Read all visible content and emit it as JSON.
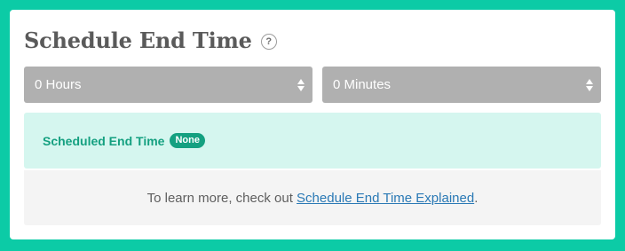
{
  "header": {
    "title": "Schedule End Time",
    "help_glyph": "?"
  },
  "selects": {
    "hours": {
      "value": "0 Hours",
      "icon": "sort-arrows-icon"
    },
    "minutes": {
      "value": "0 Minutes",
      "icon": "sort-arrows-icon"
    }
  },
  "status": {
    "label": "Scheduled End Time",
    "badge": "None"
  },
  "info": {
    "prefix": "To learn more, check out ",
    "link_text": "Schedule End Time Explained",
    "suffix": "."
  },
  "colors": {
    "background": "#0ccba6",
    "accent": "#14a080",
    "status_bg": "#d5f6ef",
    "select_bg": "#b0b0b0",
    "link": "#2a79b5"
  }
}
